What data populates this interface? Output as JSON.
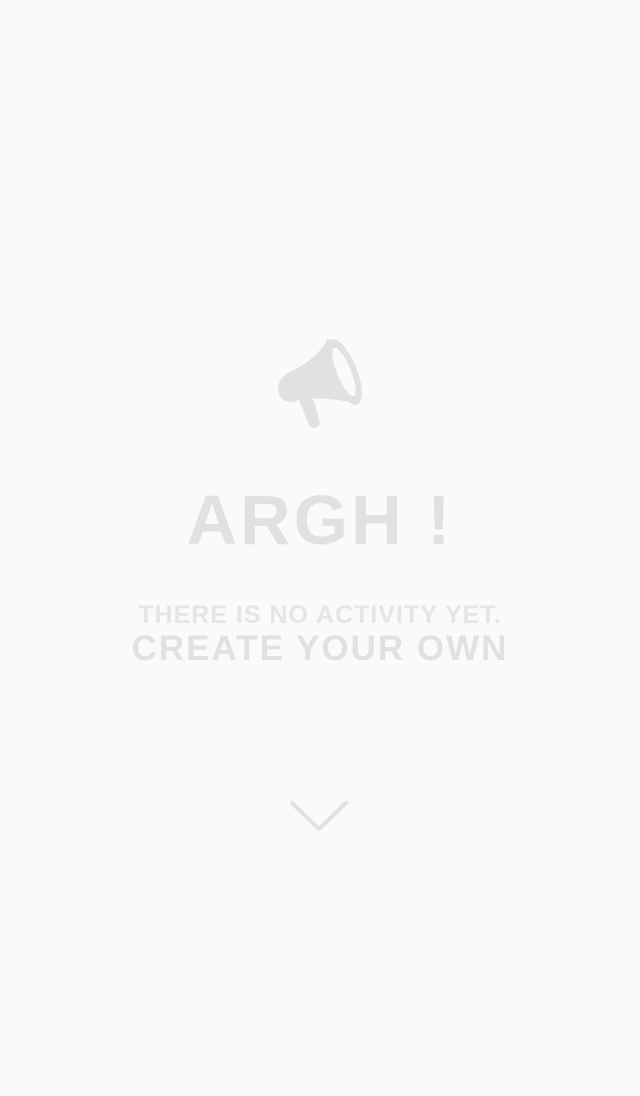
{
  "empty_state": {
    "icon": "megaphone-icon",
    "title": "ARGH !",
    "message": "THERE IS NO ACTIVITY YET.",
    "call_to_action": "CREATE YOUR OWN",
    "scroll_icon": "chevron-down-icon"
  },
  "colors": {
    "background": "#fafafa",
    "icon": "#dfe1e3",
    "text": "#e0e1e3"
  }
}
